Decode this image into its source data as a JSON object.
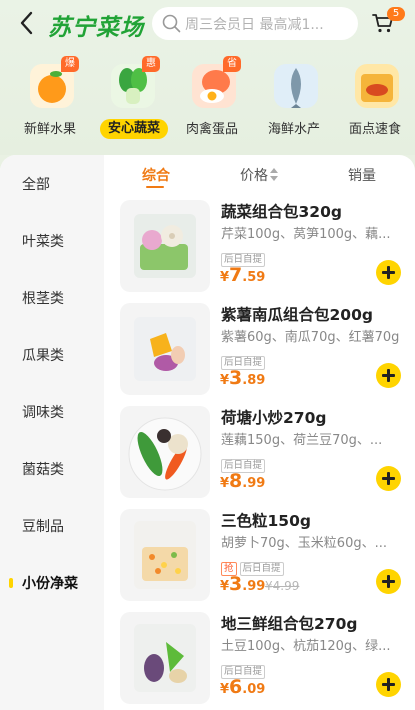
{
  "header": {
    "logo_text": "苏宁菜场",
    "search_placeholder": "周三会员日 最高减1...",
    "cart_count": "5"
  },
  "categories": [
    {
      "label": "新鲜水果",
      "tag": "爆",
      "icon": "orange-icon"
    },
    {
      "label": "安心蔬菜",
      "tag": "惠",
      "icon": "bokchoy-icon",
      "selected": true
    },
    {
      "label": "肉禽蛋品",
      "tag": "省",
      "icon": "egg-icon"
    },
    {
      "label": "海鲜水产",
      "tag": "",
      "icon": "fish-icon"
    },
    {
      "label": "面点速食",
      "tag": "",
      "icon": "noodle-icon"
    }
  ],
  "sidebar": {
    "items": [
      "全部",
      "叶菜类",
      "根茎类",
      "瓜果类",
      "调味类",
      "菌菇类",
      "豆制品",
      "小份净菜"
    ],
    "active_index": 7
  },
  "sort": {
    "comprehensive": "综合",
    "price": "价格",
    "sales": "销量"
  },
  "products": [
    {
      "name": "蔬菜组合包320g",
      "desc": "芹菜100g、莴笋100g、藕...",
      "badges": [
        "后日自提"
      ],
      "price_symbol": "¥",
      "price_int": "7",
      "price_dec": ".59",
      "orig_price": ""
    },
    {
      "name": "紫薯南瓜组合包200g",
      "desc": "紫薯60g、南瓜70g、红薯70g",
      "badges": [
        "后日自提"
      ],
      "price_symbol": "¥",
      "price_int": "3",
      "price_dec": ".89",
      "orig_price": ""
    },
    {
      "name": "荷塘小炒270g",
      "desc": "莲藕150g、荷兰豆70g、...",
      "badges": [
        "后日自提"
      ],
      "price_symbol": "¥",
      "price_int": "8",
      "price_dec": ".99",
      "orig_price": ""
    },
    {
      "name": "三色粒150g",
      "desc": "胡萝卜70g、玉米粒60g、...",
      "badges": [
        "抢",
        "后日自提"
      ],
      "price_symbol": "¥",
      "price_int": "3",
      "price_dec": ".99",
      "orig_price": "¥4.99"
    },
    {
      "name": "地三鲜组合包270g",
      "desc": "土豆100g、杭茄120g、绿...",
      "badges": [
        "后日自提"
      ],
      "price_symbol": "¥",
      "price_int": "6",
      "price_dec": ".09",
      "orig_price": ""
    }
  ],
  "colors": {
    "brand_green": "#21a336",
    "accent_yellow": "#ffd400",
    "price_orange": "#f07a14"
  }
}
